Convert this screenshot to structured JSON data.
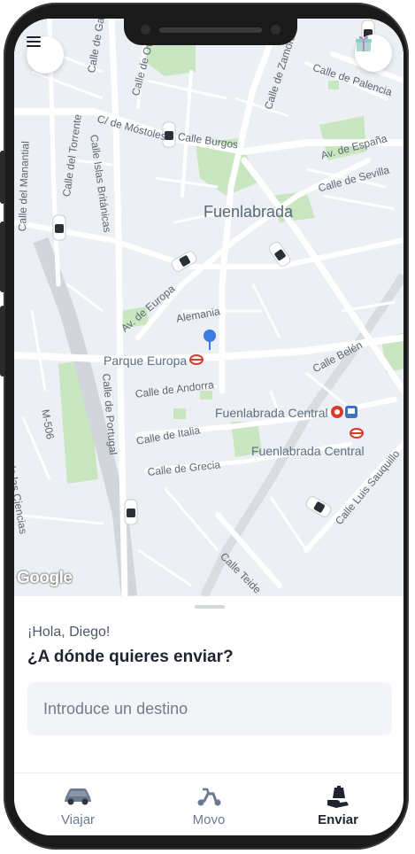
{
  "map": {
    "city_label": "Fuenlabrada",
    "streets": [
      "Calle de Galicia",
      "Calle de Oviedo",
      "Calle de Zamora",
      "Calle de Palencia",
      "C/ de Móstoles",
      "Calle Burgos",
      "Av. de España",
      "Calle de Sevilla",
      "Calle del Manantial",
      "Calle del Torrente",
      "Calle Islas Británicas",
      "Av. de Europa",
      "Alemania",
      "Calle de Andorra",
      "Calle de Portugal",
      "Calle de Italia",
      "Calle de Grecia",
      "Calle Belén",
      "M-506",
      "Calle de las Ciencias",
      "Calle Luis Sauquillo",
      "Calle Teide"
    ],
    "pois": [
      "Parque Europa",
      "Fuenlabrada Central",
      "Fuenlabrada Central"
    ],
    "google_logo": "Google"
  },
  "header": {
    "menu_icon": "hamburger-icon",
    "gift_icon": "gift-icon"
  },
  "sheet": {
    "greeting": "¡Hola, Diego!",
    "question": "¿A dónde quieres enviar?",
    "destination_placeholder": "Introduce un destino"
  },
  "tabs": [
    {
      "label": "Viajar",
      "icon": "car-icon",
      "active": false
    },
    {
      "label": "Movo",
      "icon": "scooter-icon",
      "active": false
    },
    {
      "label": "Enviar",
      "icon": "package-icon",
      "active": true
    }
  ],
  "colors": {
    "accent": "#1f2430",
    "inactive": "#6b7a90",
    "pin": "#3d7be0",
    "metro": "#d83a2e",
    "park": "#c8e6c0"
  }
}
